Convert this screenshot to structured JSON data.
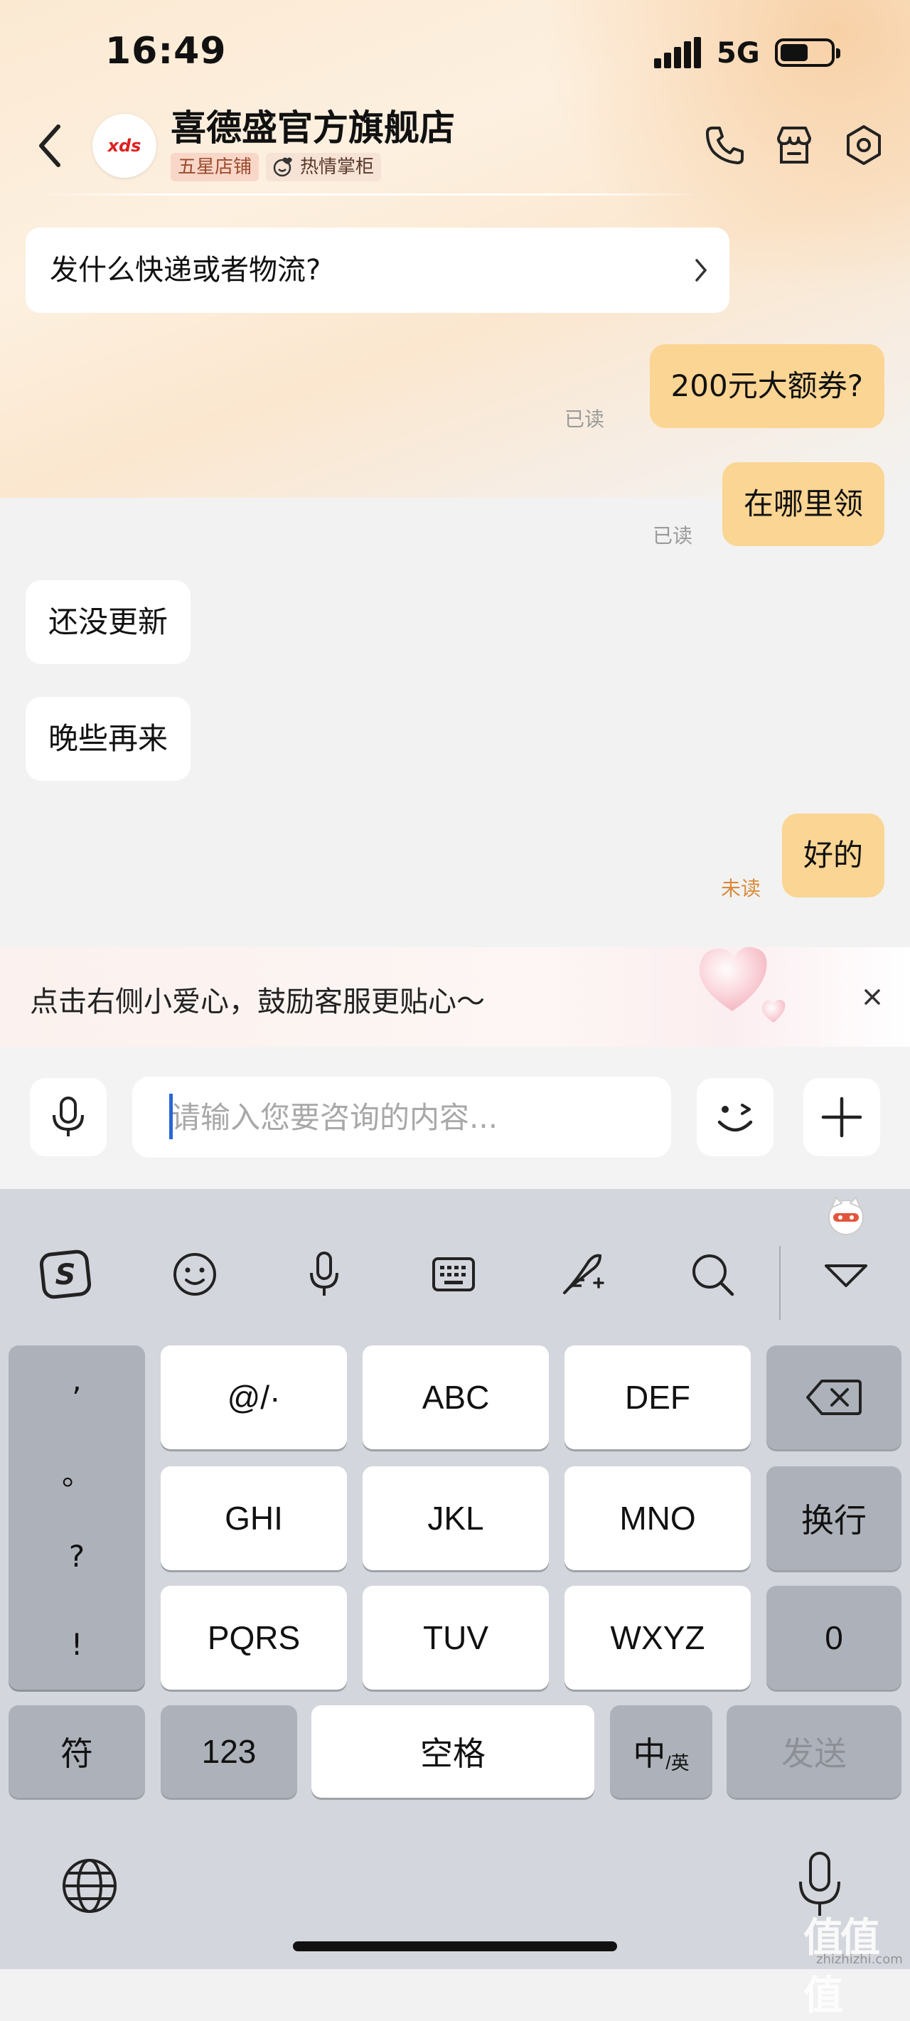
{
  "status_bar": {
    "time": "16:49",
    "network": "5G"
  },
  "header": {
    "shop_name": "喜德盛官方旗舰店",
    "logo_text": "xds",
    "badge_rating": "五星店铺",
    "badge_service": "热情掌柜"
  },
  "quick_question": "发什么快递或者物流?",
  "messages": [
    {
      "side": "right",
      "text": "200元大额券?",
      "status": "已读"
    },
    {
      "side": "right",
      "text": "在哪里领",
      "status": "已读"
    },
    {
      "side": "left",
      "text": "还没更新"
    },
    {
      "side": "left",
      "text": "晚些再来"
    },
    {
      "side": "right",
      "text": "好的",
      "status": "未读"
    }
  ],
  "tip_banner": {
    "text": "点击右侧小爱心，鼓励客服更贴心～",
    "close": "×"
  },
  "input": {
    "placeholder": "请输入您要咨询的内容..."
  },
  "keyboard": {
    "punct": [
      ",",
      "。",
      "?",
      "!"
    ],
    "row1": [
      "@/·",
      "ABC",
      "DEF"
    ],
    "row2": [
      "GHI",
      "JKL",
      "MNO"
    ],
    "row2_right": "换行",
    "row3": [
      "PQRS",
      "TUV",
      "WXYZ"
    ],
    "row3_right": "0",
    "bottom": {
      "fu": "符",
      "num": "123",
      "space": "空格",
      "lang_main": "中",
      "lang_sub": "/英",
      "send": "发送"
    }
  },
  "watermark": {
    "main": "值值值",
    "url": "zhizhizhi.com"
  },
  "colors": {
    "bubble_right": "#fbd593",
    "unread": "#d98a3a",
    "caret": "#2a66d6"
  }
}
